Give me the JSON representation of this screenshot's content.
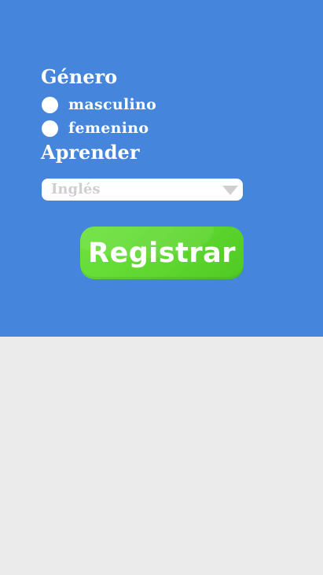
{
  "form": {
    "gender_label": "Género",
    "gender_options": [
      {
        "label": "masculino"
      },
      {
        "label": "femenino"
      }
    ],
    "learn_label": "Aprender",
    "language_select": {
      "value": "Inglés"
    },
    "register_button": "Registrar"
  },
  "colors": {
    "panel_background": "#4586dc",
    "page_background": "#ebebeb",
    "button_green": "#5fd730",
    "select_text": "#cfcfcf"
  },
  "icons": {
    "select_arrow": "triangle-down-icon"
  }
}
